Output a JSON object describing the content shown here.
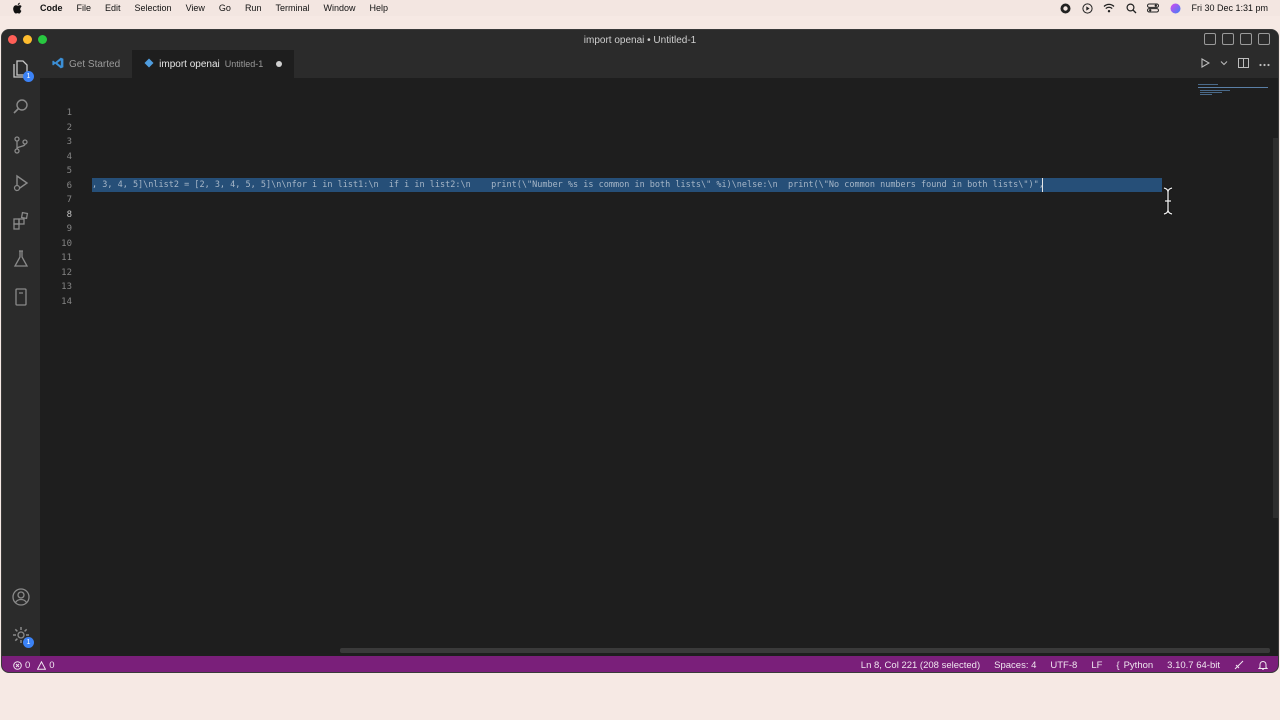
{
  "menubar": {
    "items": [
      "Code",
      "File",
      "Edit",
      "Selection",
      "View",
      "Go",
      "Run",
      "Terminal",
      "Window",
      "Help"
    ],
    "clock": "Fri 30 Dec  1:31 pm"
  },
  "window": {
    "title": "import openai • Untitled-1"
  },
  "activity": {
    "explorer_badge": "1",
    "settings_badge": "1"
  },
  "tabs": [
    {
      "label": "Get Started",
      "sub": ""
    },
    {
      "label": "import openai",
      "sub": "Untitled-1",
      "dirty": true
    }
  ],
  "editor": {
    "line_numbers": [
      "1",
      "2",
      "3",
      "4",
      "5",
      "6",
      "7",
      "8",
      "9",
      "10",
      "11",
      "12",
      "13",
      "14"
    ],
    "current_line": 8,
    "selected_text": ", 3, 4, 5]\\nlist2 = [2, 3, 4, 5, 5]\\n\\nfor i in list1:\\n  if i in list2:\\n    print(\\\"Number %s is common in both lists\\\" %i)\\nelse:\\n  print(\\\"No common numbers found in both lists\\\")\","
  },
  "statusbar": {
    "errors": "0",
    "warnings": "0",
    "position": "Ln 8, Col 221 (208 selected)",
    "spaces": "Spaces: 4",
    "encoding": "UTF-8",
    "eol": "LF",
    "language": "Python",
    "interpreter": "3.10.7 64-bit"
  },
  "colors": {
    "statusbar": "#7a1f7a",
    "selection": "#264f78",
    "editor_bg": "#1e1e1e"
  }
}
